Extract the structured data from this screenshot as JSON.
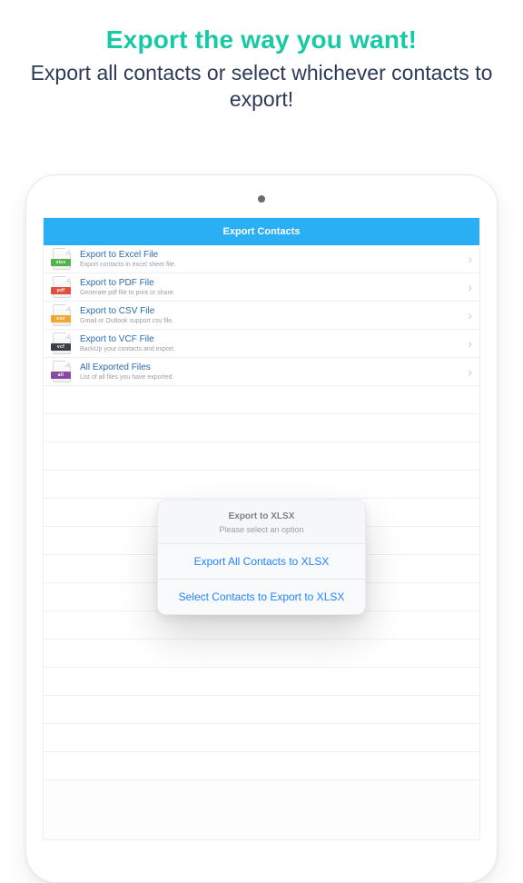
{
  "hero": {
    "headline": "Export the way you want!",
    "subline": "Export all contacts or select whichever contacts to export!"
  },
  "navbar": {
    "title": "Export Contacts"
  },
  "rows": [
    {
      "tag": "xlsx",
      "tagColor": "#53b24a",
      "title": "Export to Excel File",
      "sub": "Export contacts in excel sheet file."
    },
    {
      "tag": "pdf",
      "tagColor": "#e04f3d",
      "title": "Export to PDF File",
      "sub": "Generate pdf file to print or share."
    },
    {
      "tag": "csv",
      "tagColor": "#f0a733",
      "title": "Export to CSV File",
      "sub": "Gmail or Outlook support csv file."
    },
    {
      "tag": "vcf",
      "tagColor": "#3a3f45",
      "title": "Export to VCF File",
      "sub": "BackUp your contacts and export."
    },
    {
      "tag": "all",
      "tagColor": "#8b4aa2",
      "title": "All Exported Files",
      "sub": "List of all files you have exported."
    }
  ],
  "popup": {
    "title": "Export to XLSX",
    "message": "Please select an option",
    "primary": "Export All Contacts to XLSX",
    "secondary": "Select Contacts to Export to XLSX"
  },
  "colors": {
    "accent": "#17c9a4",
    "navbar": "#2aaff5",
    "link": "#1f84ff"
  }
}
